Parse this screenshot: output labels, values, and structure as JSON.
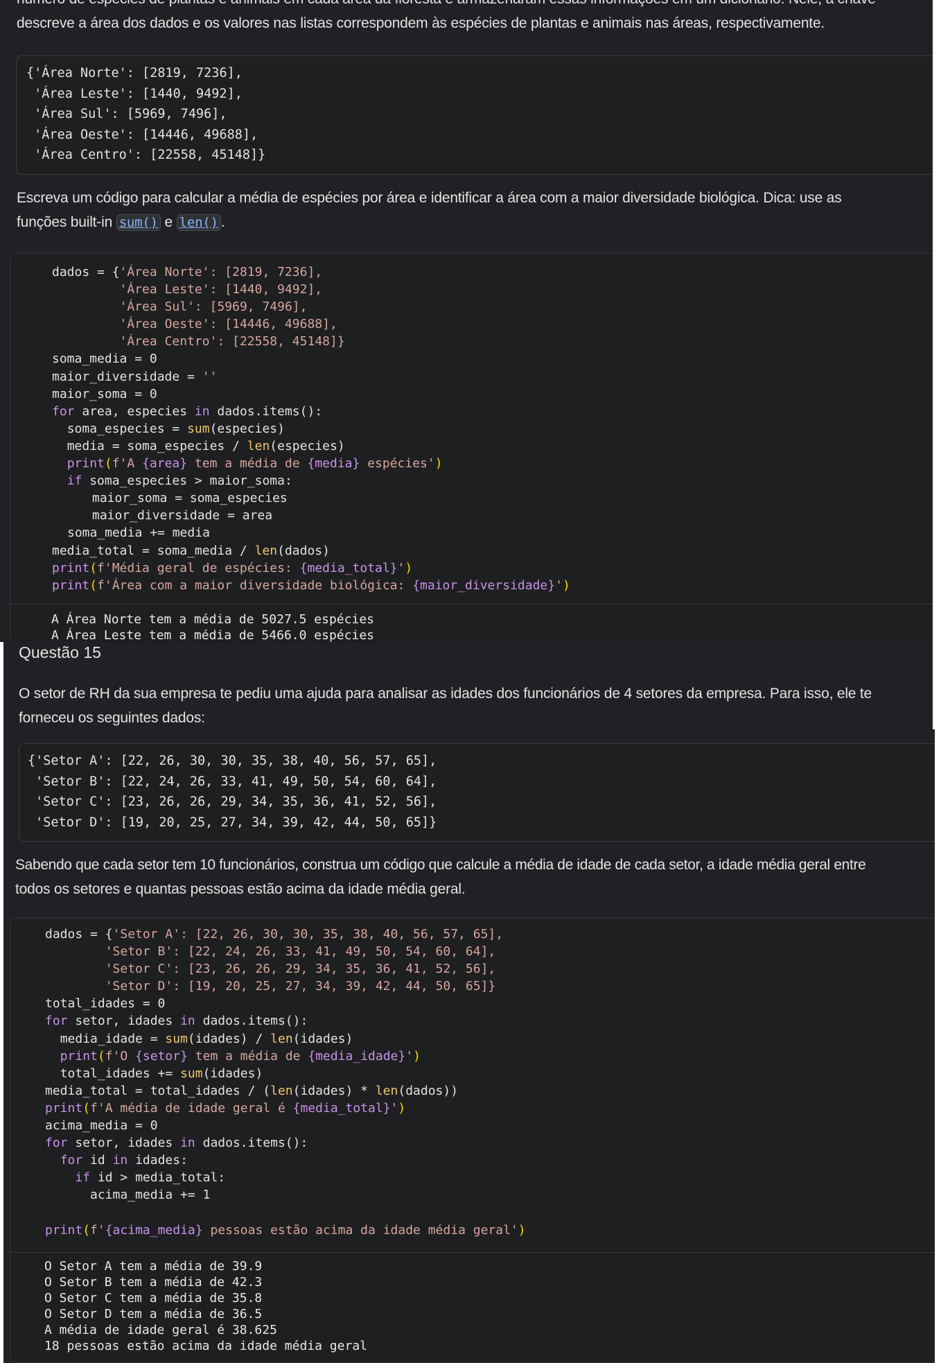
{
  "colors": {
    "panel_bg": "#202124",
    "code_bg": "#1e1f20",
    "text": "#e3e3e3",
    "keyword": "#c792ea",
    "string": "#d7a6a0",
    "inline_code": "#8ab4f8"
  },
  "q14": {
    "intro_line1": "número de espécies de plantas e animais em cada área da floresta e armazenaram essas informações em um dicionário. Nele, a chave",
    "intro_line2": "descreve a área dos dados e os valores nas listas correspondem às espécies de plantas e animais nas áreas, respectivamente.",
    "dict_lines": [
      "{'Área Norte': [2819, 7236],",
      " 'Área Leste': [1440, 9492],",
      " 'Área Sul': [5969, 7496],",
      " 'Área Oeste': [14446, 49688],",
      " 'Área Centro': [22558, 45148]}"
    ],
    "task_part1": "Escreva um código para calcular a média de espécies por área e identificar a área com a maior diversidade biológica. Dica: use as",
    "task_part2": "funções built-in ",
    "task_code1": "sum()",
    "task_mid": " e ",
    "task_code2": "len()",
    "task_end": ".",
    "code": {
      "l01_a": "dados = {",
      "l01_b": "'Área Norte'",
      "l01_c": ": [2819, 7236],",
      "l02_b": "'Área Leste'",
      "l02_c": ": [1440, 9492],",
      "l03_b": "'Área Sul'",
      "l03_c": ": [5969, 7496],",
      "l04_b": "'Área Oeste'",
      "l04_c": ": [14446, 49688],",
      "l05_b": "'Área Centro'",
      "l05_c": ": [22558, 45148]}",
      "l06": "soma_media = 0",
      "l07_a": "maior_diversidade = ",
      "l07_b": "''",
      "l08": "maior_soma = 0",
      "l09_a": "for",
      "l09_b": " area, especies ",
      "l09_c": "in",
      "l09_d": " dados.items():",
      "l10_a": "soma_especies = ",
      "l10_b": "sum",
      "l10_c": "(especies)",
      "l11_a": "media = soma_especies / ",
      "l11_b": "len",
      "l11_c": "(especies)",
      "l12_a": "print",
      "l12_b": "(",
      "l12_c": "f'A ",
      "l12_d": "{area}",
      "l12_e": " tem a média de ",
      "l12_f": "{media}",
      "l12_g": " espécies'",
      "l12_h": ")",
      "l13_a": "if",
      "l13_b": " soma_especies > maior_soma:",
      "l14": "maior_soma = soma_especies",
      "l15": "maior_diversidade = area",
      "l16": "soma_media += media",
      "l17_a": "media_total = soma_media / ",
      "l17_b": "len",
      "l17_c": "(dados)",
      "l18_a": "print",
      "l18_b": "(",
      "l18_c": "f'Média geral de espécies: ",
      "l18_d": "{media_total}",
      "l18_e": "'",
      "l18_f": ")",
      "l19_a": "print",
      "l19_b": "(",
      "l19_c": "f'Área com a maior diversidade biológica: ",
      "l19_d": "{maior_diversidade}",
      "l19_e": "'",
      "l19_f": ")"
    },
    "output": [
      "A Área Norte tem a média de 5027.5 espécies",
      "A Área Leste tem a média de 5466.0 espécies"
    ]
  },
  "q15": {
    "heading": "Questão 15",
    "intro_line1": "O setor de RH da sua empresa te pediu uma ajuda para analisar as idades dos funcionários de 4 setores da empresa. Para isso, ele te",
    "intro_line2": "forneceu os seguintes dados:",
    "dict_lines": [
      "{'Setor A': [22, 26, 30, 30, 35, 38, 40, 56, 57, 65],",
      " 'Setor B': [22, 24, 26, 33, 41, 49, 50, 54, 60, 64],",
      " 'Setor C': [23, 26, 26, 29, 34, 35, 36, 41, 52, 56],",
      " 'Setor D': [19, 20, 25, 27, 34, 39, 42, 44, 50, 65]}"
    ],
    "task_line1": "Sabendo que cada setor tem 10 funcionários, construa um código que calcule a média de idade de cada setor, a idade média geral entre",
    "task_line2": "todos os setores e quantas pessoas estão acima da idade média geral.",
    "code": {
      "l01_a": "dados = {",
      "l01_b": "'Setor A'",
      "l01_c": ": [22, 26, 30, 30, 35, 38, 40, 56, 57, 65],",
      "l02_b": "'Setor B'",
      "l02_c": ": [22, 24, 26, 33, 41, 49, 50, 54, 60, 64],",
      "l03_b": "'Setor C'",
      "l03_c": ": [23, 26, 26, 29, 34, 35, 36, 41, 52, 56],",
      "l04_b": "'Setor D'",
      "l04_c": ": [19, 20, 25, 27, 34, 39, 42, 44, 50, 65]}",
      "l05": "total_idades = 0",
      "l06_a": "for",
      "l06_b": " setor, idades ",
      "l06_c": "in",
      "l06_d": " dados.items():",
      "l07_a": "media_idade = ",
      "l07_b": "sum",
      "l07_c": "(idades) / ",
      "l07_d": "len",
      "l07_e": "(idades)",
      "l08_a": "print",
      "l08_b": "(",
      "l08_c": "f'O ",
      "l08_d": "{setor}",
      "l08_e": " tem a média de ",
      "l08_f": "{media_idade}",
      "l08_g": "'",
      "l08_h": ")",
      "l09_a": "total_idades += ",
      "l09_b": "sum",
      "l09_c": "(idades)",
      "l10_a": "media_total = total_idades / (",
      "l10_b": "len",
      "l10_c": "(idades) * ",
      "l10_d": "len",
      "l10_e": "(dados))",
      "l11_a": "print",
      "l11_b": "(",
      "l11_c": "f'A média de idade geral é ",
      "l11_d": "{media_total}",
      "l11_e": "'",
      "l11_f": ")",
      "l12": "acima_media = 0",
      "l13_a": "for",
      "l13_b": " setor, idades ",
      "l13_c": "in",
      "l13_d": " dados.items():",
      "l14_a": "for",
      "l14_b": " id ",
      "l14_c": "in",
      "l14_d": " idades:",
      "l15_a": "if",
      "l15_b": " id > media_total:",
      "l16": "acima_media += 1",
      "l18_a": "print",
      "l18_b": "(",
      "l18_c": "f'",
      "l18_d": "{acima_media}",
      "l18_e": " pessoas estão acima da idade média geral'",
      "l18_f": ")"
    },
    "output": [
      "O Setor A tem a média de 39.9",
      "O Setor B tem a média de 42.3",
      "O Setor C tem a média de 35.8",
      "O Setor D tem a média de 36.5",
      "A média de idade geral é 38.625",
      "18 pessoas estão acima da idade média geral"
    ]
  }
}
